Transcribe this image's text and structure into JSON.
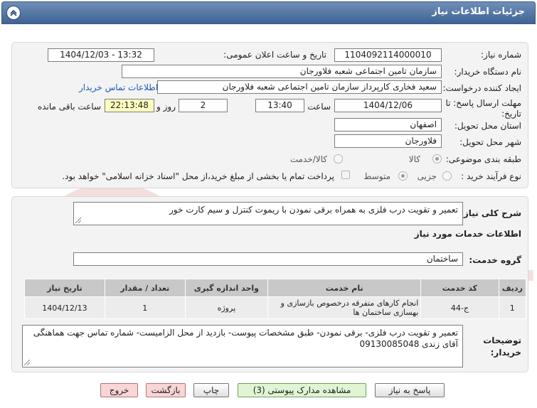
{
  "header": {
    "title": "جزئیات اطلاعات نیاز"
  },
  "fields": {
    "need_number_label": "شماره نیاز:",
    "need_number": "1104092114000010",
    "announce_label": "تاریخ و ساعت اعلان عمومی:",
    "announce_value": "1404/12/03 - 13:32",
    "buyer_org_label": "نام دستگاه خریدار:",
    "buyer_org": "سازمان تامین اجتماعی شعبه فلاورجان",
    "creator_label": "ایجاد کننده درخواست:",
    "creator": "سعید فخاری کارپرداز سازمان تامین اجتماعی شعبه فلاورجان",
    "contact_link": "اطلاعات تماس خریدار",
    "deadline_label_line1": "مهلت ارسال پاسخ: تا",
    "deadline_label_line2": "تاریخ:",
    "deadline_date": "1404/12/06",
    "time_label": "ساعت",
    "deadline_time": "13:40",
    "days_value": "2",
    "days_label": "روز و",
    "remaining_value": "22:13:48",
    "remaining_label": "ساعت باقی مانده",
    "province_label": "استان محل تحویل:",
    "province": "اصفهان",
    "city_label": "شهر محل تحویل:",
    "city": "فلاورجان",
    "category_label": "طبقه بندی موضوعی:",
    "category_options": [
      "کالا",
      "کالا/خدمت"
    ],
    "process_label": "نوع فرآیند خرید :",
    "process_options": [
      "جزیی",
      "متوسط"
    ],
    "payment_note": "پرداخت تمام یا بخشی از مبلغ خرید،از محل \"اسناد خزانه اسلامی\" خواهد بود."
  },
  "summary": {
    "label": "شرح کلی نیاز:",
    "value": "تعمیر و تقویت درب فلزی به همراه برقی نمودن با ریموت کنترل و سیم کارت خور"
  },
  "services_section_title": "اطلاعات خدمات مورد نیاز",
  "service_group": {
    "label": "گروه خدمت:",
    "value": "ساختمان"
  },
  "table": {
    "headers": [
      "ردیف",
      "کد خدمت",
      "نام خدمت",
      "واحد اندازه گیری",
      "تعداد / مقدار",
      "تاریخ نیاز"
    ],
    "rows": [
      [
        "1",
        "ج-44",
        "انجام کارهای متفرقه درخصوص بازسازی و بهسازی ساختمان ها",
        "پروژه",
        "1",
        "1404/12/13"
      ]
    ]
  },
  "buyer_notes": {
    "label_line1": "توضیحات",
    "label_line2": "خریدار:",
    "value": "تعمیر و تقویت درب فلزی- برقی نمودن- طبق مشخصات پیوست- بازدید از محل الزامیست- شماره تماس جهت هماهنگی آقای زندی 09130085048"
  },
  "buttons": {
    "reply": "پاسخ به نیاز",
    "attachments": "مشاهده مدارک پیوستی (3)",
    "print": "چاپ",
    "back": "بازگشت",
    "exit": "خروج"
  },
  "watermark": {
    "text": "AriaTender.net"
  },
  "colors": {
    "header": "#4f72a2",
    "panel": "#f3f3f3",
    "link": "#1e58b8",
    "remaining_bg": "#ffffbf"
  }
}
